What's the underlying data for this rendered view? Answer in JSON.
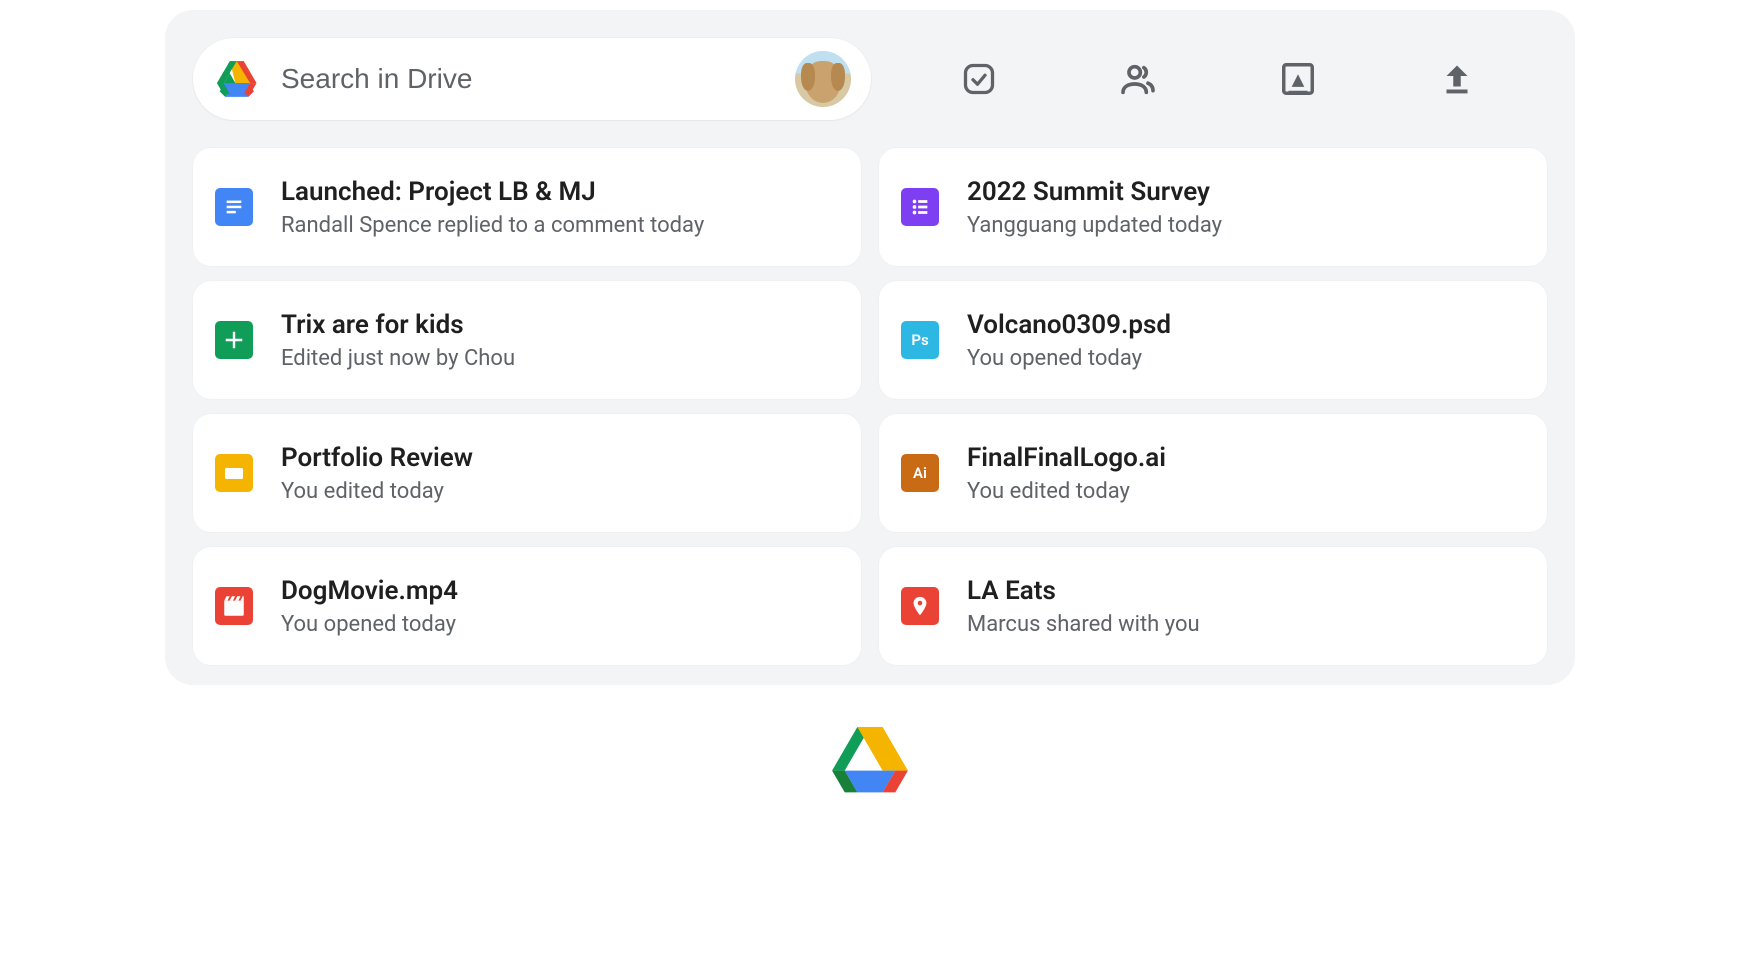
{
  "search": {
    "placeholder": "Search in Drive"
  },
  "toolbar": {
    "items": [
      {
        "name": "approvals-icon"
      },
      {
        "name": "shared-icon"
      },
      {
        "name": "image-icon"
      },
      {
        "name": "upload-icon"
      }
    ]
  },
  "files": [
    {
      "icon": "docs",
      "title": "Launched: Project LB & MJ",
      "subtitle": "Randall Spence replied to a comment today"
    },
    {
      "icon": "forms",
      "title": "2022 Summit Survey",
      "subtitle": "Yangguang updated today"
    },
    {
      "icon": "sheets",
      "title": "Trix are for kids",
      "subtitle": "Edited just now by Chou"
    },
    {
      "icon": "ps",
      "title": "Volcano0309.psd",
      "subtitle": "You opened today"
    },
    {
      "icon": "slides",
      "title": "Portfolio Review",
      "subtitle": "You edited today"
    },
    {
      "icon": "ai",
      "title": "FinalFinalLogo.ai",
      "subtitle": "You edited today"
    },
    {
      "icon": "video",
      "title": "DogMovie.mp4",
      "subtitle": "You opened today"
    },
    {
      "icon": "map",
      "title": "LA Eats",
      "subtitle": "Marcus shared with you"
    }
  ],
  "ai_label": "Ai",
  "ps_label": "Ps"
}
